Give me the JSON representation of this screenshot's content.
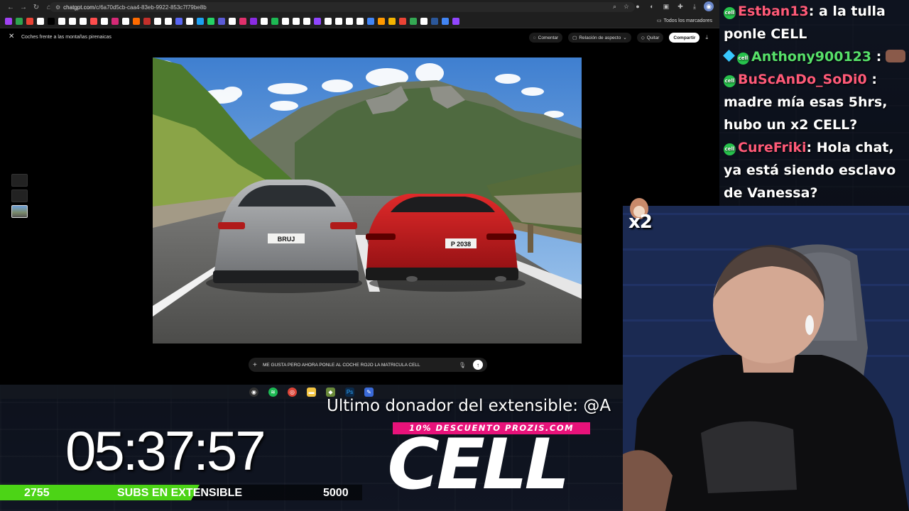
{
  "browser": {
    "url_host": "chatgpt.com",
    "url_path": "/c/6a70d5cb-caa4-83eb-9922-853c7f79be8b",
    "bookmarks_all_label": "Todos los marcadores",
    "bookmark_colors": [
      "#a142f4",
      "#2ea44f",
      "#ea4335",
      "#ffffff",
      "#000000",
      "#ffffff",
      "#ffffff",
      "#ffffff",
      "#ff4d4d",
      "#ffffff",
      "#d62976",
      "#ffffff",
      "#ff6b00",
      "#c4302b",
      "#ffffff",
      "#ffffff",
      "#5865f2",
      "#ffffff",
      "#1da1f2",
      "#25d366",
      "#5b5bd6",
      "#ffffff",
      "#e1306c",
      "#8a2be2",
      "#ffffff",
      "#1db954",
      "#ffffff",
      "#ffffff",
      "#ffffff",
      "#9146ff",
      "#ffffff",
      "#ffffff",
      "#ffffff",
      "#ffffff",
      "#4285f4",
      "#ff9900",
      "#f4b400",
      "#ea4335",
      "#34a853",
      "#ffffff",
      "#2b579a",
      "#4285f4",
      "#9146ff"
    ]
  },
  "app": {
    "conversation_title": "Coches frente a las montañas pirenaicas",
    "comment_label": "Comentar",
    "aspect_label": "Relación de aspecto",
    "remove_label": "Quitar",
    "share_label": "Compartir"
  },
  "image": {
    "plate_left": "BRUJ",
    "plate_right": "P 2038"
  },
  "composer": {
    "text": "ME GUSTA PERO AHORA PONLE AL COCHE ROJO LA MATRICULA CELL"
  },
  "chat": {
    "messages": [
      {
        "user": "Estban13",
        "sep": ":",
        "text": "a la tulla ponle CELL"
      },
      {
        "user": "Anthony900123",
        "sep": ":",
        "text": ""
      },
      {
        "user": "BuScAnDo_SoDi0",
        "sep": ":",
        "text": "madre mía esas 5hrs, hubo un x2 CELL?"
      },
      {
        "user": "CureFriki",
        "sep": ":",
        "text": "Hola chat, ya está siendo esclavo de Vanessa?"
      }
    ],
    "badge_text": "cell"
  },
  "overlay": {
    "multiplier": "x2",
    "donor_text": "Ultimo donador del extensible: @A",
    "promo_text": "10% DESCUENTO PROZIS.COM",
    "logo_text": "CELL",
    "timer": "05:37:57",
    "subs_current": "2755",
    "subs_label": "SUBS EN EXTENSIBLE",
    "subs_goal": "5000",
    "subs_progress_fraction": 0.551
  }
}
